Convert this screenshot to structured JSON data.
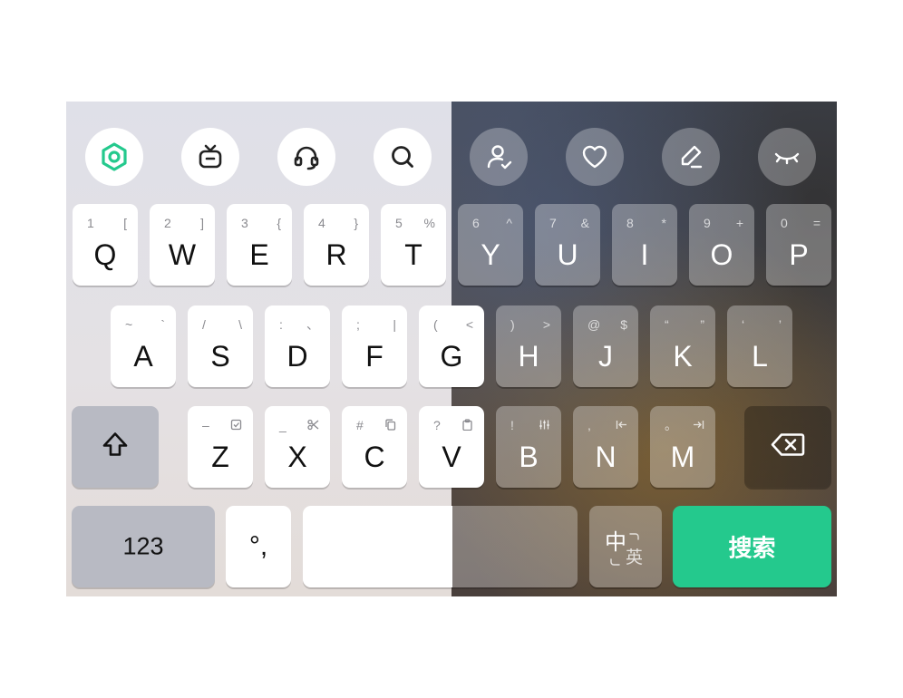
{
  "toolbar": {
    "icons": [
      "app-logo-icon",
      "tv-icon",
      "headset-icon",
      "search-icon",
      "user-edit-icon",
      "heart-icon",
      "pen-icon",
      "eye-closed-icon"
    ]
  },
  "keys": {
    "row1": [
      {
        "main": "Q",
        "sub1": "1",
        "sub2": "["
      },
      {
        "main": "W",
        "sub1": "2",
        "sub2": "]"
      },
      {
        "main": "E",
        "sub1": "3",
        "sub2": "{"
      },
      {
        "main": "R",
        "sub1": "4",
        "sub2": "}"
      },
      {
        "main": "T",
        "sub1": "5",
        "sub2": "%"
      },
      {
        "main": "Y",
        "sub1": "6",
        "sub2": "^"
      },
      {
        "main": "U",
        "sub1": "7",
        "sub2": "&"
      },
      {
        "main": "I",
        "sub1": "8",
        "sub2": "*"
      },
      {
        "main": "O",
        "sub1": "9",
        "sub2": "+"
      },
      {
        "main": "P",
        "sub1": "0",
        "sub2": "="
      }
    ],
    "row2": [
      {
        "main": "A",
        "sub1": "~",
        "sub2": "`"
      },
      {
        "main": "S",
        "sub1": "/",
        "sub2": "\\"
      },
      {
        "main": "D",
        "sub1": ":",
        "sub2": "、"
      },
      {
        "main": "F",
        "sub1": ";",
        "sub2": "|"
      },
      {
        "main": "G",
        "sub1": "(",
        "sub2": "<"
      },
      {
        "main": "H",
        "sub1": ")",
        "sub2": ">"
      },
      {
        "main": "J",
        "sub1": "@",
        "sub2": "$"
      },
      {
        "main": "K",
        "sub1": "“",
        "sub2": "”"
      },
      {
        "main": "L",
        "sub1": "‘",
        "sub2": "’"
      }
    ],
    "row3": [
      {
        "main": "Z",
        "sub1": "–",
        "icon": "select-all-icon"
      },
      {
        "main": "X",
        "sub1": "_",
        "icon": "scissors-icon"
      },
      {
        "main": "C",
        "sub1": "#",
        "icon": "copy-icon"
      },
      {
        "main": "V",
        "sub1": "?",
        "icon": "paste-icon"
      },
      {
        "main": "B",
        "sub1": "!",
        "icon": "sliders-icon"
      },
      {
        "main": "N",
        "sub1": ",",
        "icon": "cursor-start-icon"
      },
      {
        "main": "M",
        "sub1": "。",
        "icon": "cursor-end-icon"
      }
    ],
    "numbers_label": "123",
    "punct_label": "°,",
    "lang_primary": "中",
    "lang_secondary": "英",
    "search_label": "搜索"
  },
  "colors": {
    "accent": "#24c98d",
    "key_light": "#ffffff",
    "function_key": "#b8bac3"
  }
}
